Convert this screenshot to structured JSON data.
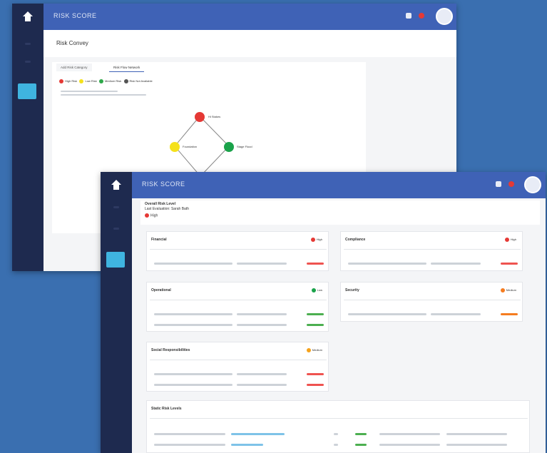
{
  "app": {
    "brand": "RISK SCORE"
  },
  "window1": {
    "page_title": "Risk Convey",
    "tabs": [
      "Add Risk Category",
      "Risk Flow Network"
    ],
    "legend": [
      {
        "label": "High Risk",
        "color": "#e53935"
      },
      {
        "label": "Low Risk",
        "color": "#f5e11b"
      },
      {
        "label": "Medium Risk",
        "color": "#2ea84a"
      },
      {
        "label": "Risk Not Available",
        "color": "#555555"
      }
    ],
    "nodes": [
      {
        "label": "Hi Stakes",
        "color": "#e53935"
      },
      {
        "label": "Foundation",
        "color": "#f5e11b"
      },
      {
        "label": "Stage Flood",
        "color": "#1aa24a"
      }
    ]
  },
  "window2": {
    "overall_title": "Overall Risk Level",
    "overall_sub": "Last Evaluation: Sarah Bath",
    "overall_badge": "High",
    "cards": [
      {
        "title": "Financial",
        "status": "High",
        "color": "#e53935"
      },
      {
        "title": "Compliance",
        "status": "High",
        "color": "#e53935"
      },
      {
        "title": "Operational",
        "status": "Low",
        "color": "#1aa24a"
      },
      {
        "title": "Security",
        "status": "Medium",
        "color": "#f57c1f"
      },
      {
        "title": "Social Responsibilities",
        "status": "Medium",
        "color": "#f5a21b"
      }
    ],
    "table_title": "Static Risk Levels"
  },
  "icons": [
    "home-icon",
    "dashboard-icon",
    "bell-icon",
    "flag-icon",
    "avatar-icon"
  ]
}
